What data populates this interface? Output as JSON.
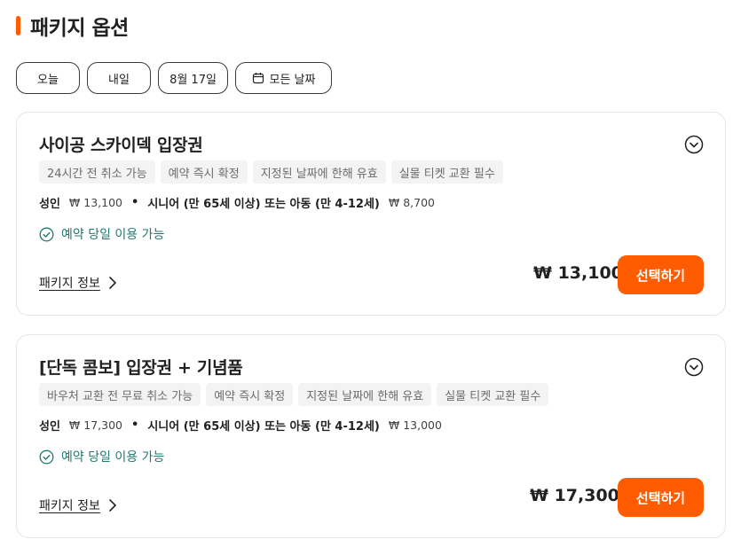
{
  "header": {
    "title": "패키지 옵션",
    "accent_color": "#ff5b00"
  },
  "date_chips": [
    {
      "label": "오늘"
    },
    {
      "label": "내일"
    },
    {
      "label": "8월 17일"
    },
    {
      "label": "모든 날짜",
      "icon": "calendar-icon"
    }
  ],
  "packages": [
    {
      "title": "사이공 스카이덱 입장권",
      "tags": [
        "24시간 전 취소 가능",
        "예약 즉시 확정",
        "지정된 날짜에 한해 유효",
        "실물 티켓 교환 필수"
      ],
      "price_rows": {
        "adult_label": "성인",
        "adult_price": "₩ 13,100",
        "separator": "•",
        "senior_label": "시니어 (만 65세 이상) 또는 아동 (만 4-12세)",
        "senior_price": "₩ 8,700"
      },
      "same_day": "예약 당일 이용 가능",
      "info_link": "패키지 정보",
      "total": "₩ 13,100",
      "select_label": "선택하기"
    },
    {
      "title": "[단독 콤보] 입장권 + 기념품",
      "tags": [
        "바우처 교환 전 무료 취소 가능",
        "예약 즉시 확정",
        "지정된 날짜에 한해 유효",
        "실물 티켓 교환 필수"
      ],
      "price_rows": {
        "adult_label": "성인",
        "adult_price": "₩ 17,300",
        "separator": "•",
        "senior_label": "시니어 (만 65세 이상) 또는 아동 (만 4-12세)",
        "senior_price": "₩ 13,000"
      },
      "same_day": "예약 당일 이용 가능",
      "info_link": "패키지 정보",
      "total": "₩ 17,300",
      "select_label": "선택하기"
    }
  ],
  "colors": {
    "primary": "#ff5b00",
    "success": "#1f7a70",
    "tag_bg": "#f3f3f3"
  }
}
